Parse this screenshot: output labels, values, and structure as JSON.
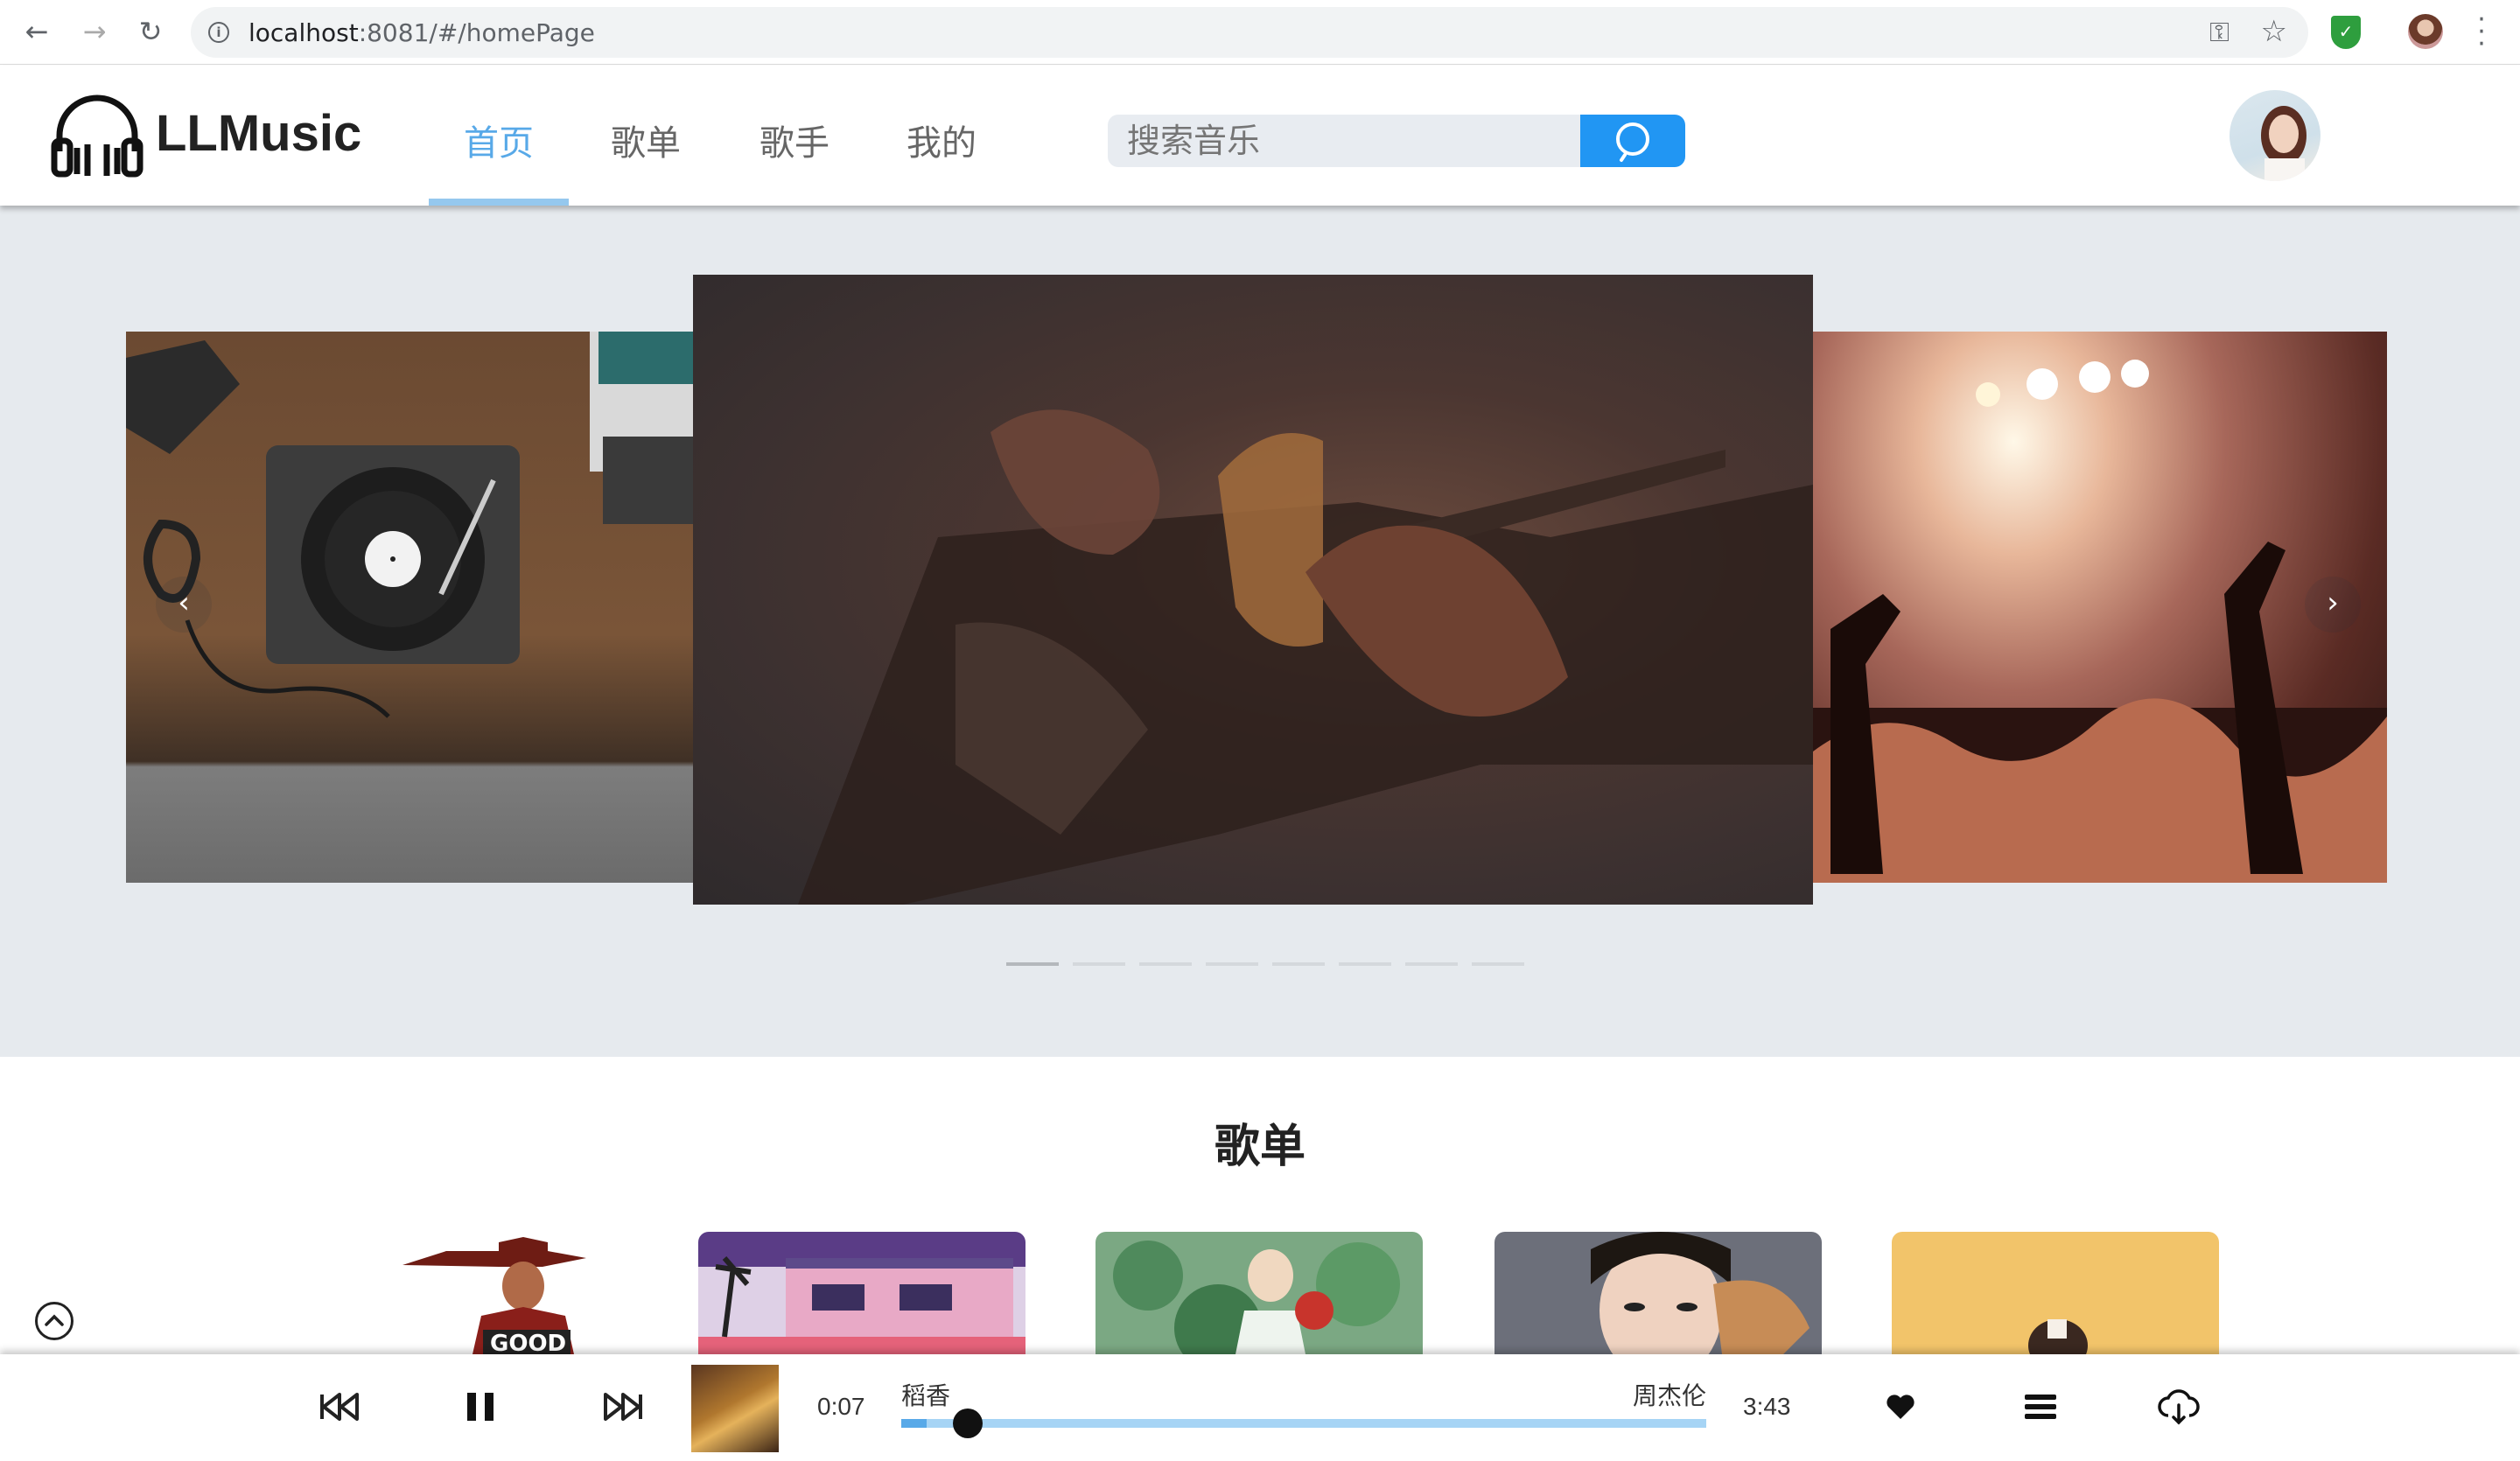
{
  "browser": {
    "url_host": "localhost",
    "url_rest": ":8081/#/homePage"
  },
  "header": {
    "logo_text": "LLMusic",
    "nav": [
      {
        "label": "首页",
        "active": true
      },
      {
        "label": "歌单",
        "active": false
      },
      {
        "label": "歌手",
        "active": false
      },
      {
        "label": "我的",
        "active": false
      }
    ],
    "search_placeholder": "搜索音乐"
  },
  "carousel": {
    "slides": [
      "turntable-desk",
      "guitar-player",
      "concert-crowd"
    ],
    "indicator_count": 8,
    "active_index": 0
  },
  "section": {
    "title": "歌单"
  },
  "player": {
    "current_time": "0:07",
    "duration": "3:43",
    "song": "稻香",
    "artist": "周杰伦",
    "progress": 0.032
  },
  "colors": {
    "accent": "#58a9e8",
    "search_button": "#2196f3",
    "banner_bg": "#e6eaee"
  }
}
